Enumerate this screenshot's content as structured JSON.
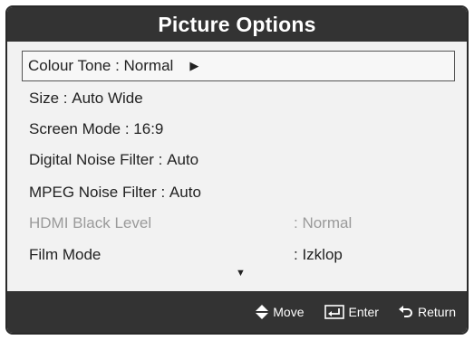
{
  "title": "Picture Options",
  "menu": {
    "items": [
      {
        "label": "Colour Tone",
        "sep": " : ",
        "value": "Normal",
        "has_submenu": true
      },
      {
        "label": "Size",
        "sep": " : ",
        "value": "Auto Wide"
      },
      {
        "label": "Screen Mode",
        "sep": " : ",
        "value": "16:9"
      },
      {
        "label": "Digital Noise Filter",
        "sep": " : ",
        "value": "Auto"
      },
      {
        "label": "MPEG Noise Filter",
        "sep": " : ",
        "value": "Auto"
      },
      {
        "label": "HDMI Black Level",
        "value_col": ": Normal",
        "disabled": true
      },
      {
        "label": "Film Mode",
        "value_col": ": Izklop"
      }
    ],
    "submenu_arrow": "▶",
    "scroll_down": "▼"
  },
  "footer": {
    "move": "Move",
    "enter": "Enter",
    "return": "Return"
  },
  "icons": {
    "move": "up-down-arrows-icon",
    "enter": "enter-key-icon",
    "return": "return-arrow-icon"
  },
  "colors": {
    "bar": "#333333",
    "panel": "#f2f2f2",
    "text": "#222222",
    "disabled_text": "#9a9a9a"
  }
}
